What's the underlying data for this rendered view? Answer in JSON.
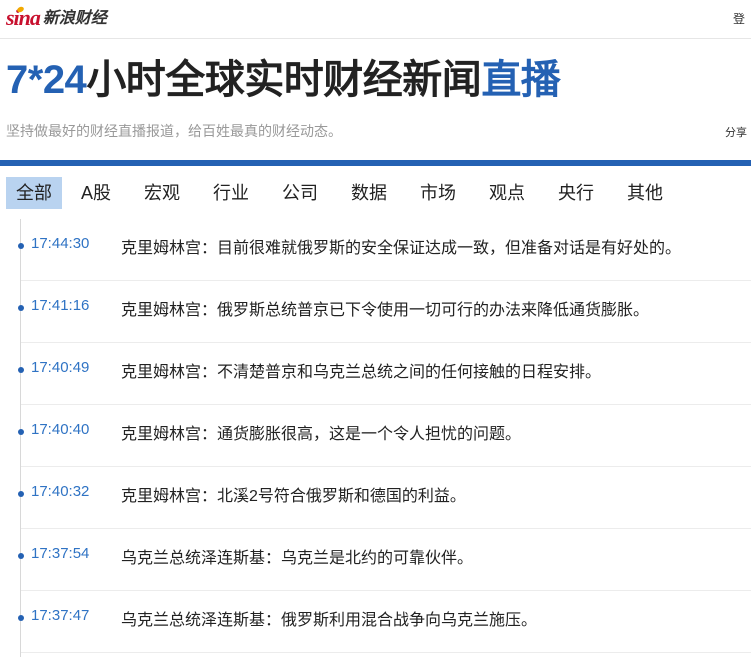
{
  "header": {
    "logo_sina": "sina",
    "logo_cn": "新浪财经",
    "login": "登"
  },
  "hero": {
    "title_prefix": "7*24",
    "title_middle": "小时全球实时财经新闻",
    "title_suffix": "直播",
    "subtitle": "坚持做最好的财经直播报道，给百姓最真的财经动态。",
    "share": "分享"
  },
  "colors": {
    "accent": "#2461b3",
    "active_tab": "#b9d3f0",
    "time": "#2f73c4",
    "brand_red": "#c8102e"
  },
  "tabs": [
    {
      "label": "全部",
      "active": true
    },
    {
      "label": "A股"
    },
    {
      "label": "宏观"
    },
    {
      "label": "行业"
    },
    {
      "label": "公司"
    },
    {
      "label": "数据"
    },
    {
      "label": "市场"
    },
    {
      "label": "观点"
    },
    {
      "label": "央行"
    },
    {
      "label": "其他"
    }
  ],
  "feed": [
    {
      "time": "17:44:30",
      "text": "克里姆林宫：目前很难就俄罗斯的安全保证达成一致，但准备对话是有好处的。"
    },
    {
      "time": "17:41:16",
      "text": "克里姆林宫：俄罗斯总统普京已下令使用一切可行的办法来降低通货膨胀。"
    },
    {
      "time": "17:40:49",
      "text": "克里姆林宫：不清楚普京和乌克兰总统之间的任何接触的日程安排。"
    },
    {
      "time": "17:40:40",
      "text": "克里姆林宫：通货膨胀很高，这是一个令人担忧的问题。"
    },
    {
      "time": "17:40:32",
      "text": "克里姆林宫：北溪2号符合俄罗斯和德国的利益。"
    },
    {
      "time": "17:37:54",
      "text": "乌克兰总统泽连斯基：乌克兰是北约的可靠伙伴。"
    },
    {
      "time": "17:37:47",
      "text": "乌克兰总统泽连斯基：俄罗斯利用混合战争向乌克兰施压。"
    }
  ]
}
